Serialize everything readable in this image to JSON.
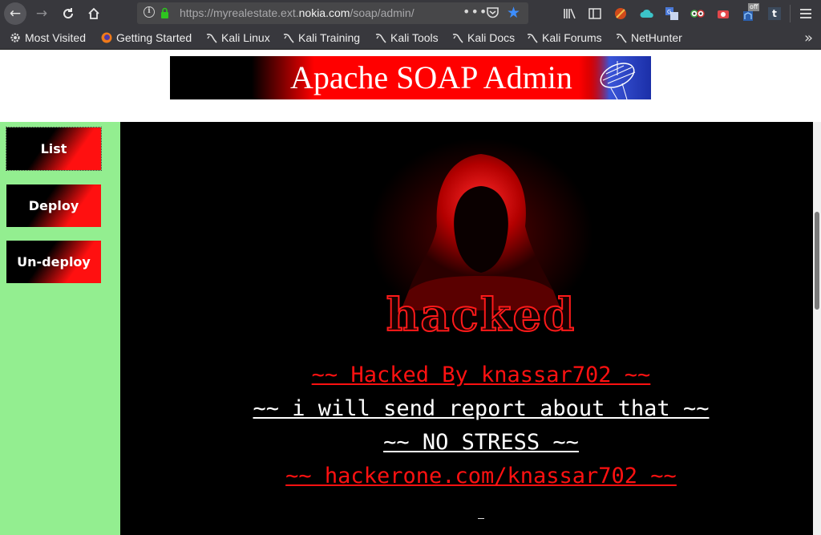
{
  "browser": {
    "url_prefix": "https://myrealestate.ext.",
    "url_domain": "nokia.com",
    "url_path": "/soap/admin/",
    "bookmarks": [
      {
        "label": "Most Visited",
        "icon": "gear-icon"
      },
      {
        "label": "Getting Started",
        "icon": "firefox-icon"
      },
      {
        "label": "Kali Linux",
        "icon": "kali-icon"
      },
      {
        "label": "Kali Training",
        "icon": "kali-icon"
      },
      {
        "label": "Kali Tools",
        "icon": "kali-icon"
      },
      {
        "label": "Kali Docs",
        "icon": "kali-icon"
      },
      {
        "label": "Kali Forums",
        "icon": "kali-icon"
      },
      {
        "label": "NetHunter",
        "icon": "kali-icon"
      }
    ],
    "addon_badge": "off",
    "addon_letter": "t"
  },
  "banner": {
    "title": "Apache SOAP Admin"
  },
  "sidebar": {
    "items": [
      {
        "label": "List"
      },
      {
        "label": "Deploy"
      },
      {
        "label": "Un-deploy"
      }
    ]
  },
  "content": {
    "art_text": "hacked",
    "messages": [
      {
        "text": "~~ Hacked By knassar702 ~~",
        "color": "red"
      },
      {
        "text": "~~ i will send report about that ~~",
        "color": "white"
      },
      {
        "text": "~~ NO STRESS ~~",
        "color": "white"
      },
      {
        "text": "~~ hackerone.com/knassar702 ~~",
        "color": "red"
      }
    ]
  },
  "colors": {
    "chrome": "#38383d",
    "sidebar": "#93ee90",
    "accent_red": "#ff1111",
    "star_blue": "#3d8eff"
  }
}
